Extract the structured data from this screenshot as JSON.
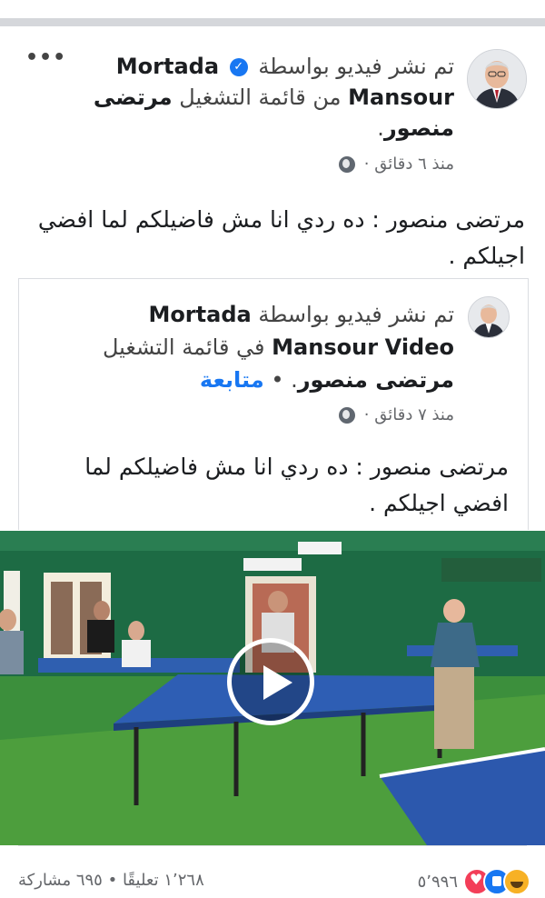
{
  "post": {
    "author": "Mortada Mansour",
    "header_line1_prefix": "تم نشر فيديو بواسطة",
    "header_author_1": "Mortada",
    "header_author_2": "Mansour",
    "header_line2_mid": "من قائمة التشغيل",
    "header_playlist_a": "مرتضى",
    "header_playlist_b": "منصور",
    "header_end": ".",
    "time": "منذ ٦ دقائق",
    "dot": "·",
    "caption": "مرتضى منصور : ده ردي انا مش فاضيلكم  لما افضي اجيلكم .",
    "more_label": "•••"
  },
  "shared": {
    "header_prefix": "تم نشر فيديو بواسطة",
    "author": "Mortada Mansour",
    "video_word": "Video",
    "in_playlist": "في قائمة التشغيل",
    "playlist": "مرتضى منصور",
    "sep": ". •",
    "follow": "متابعة",
    "time": "منذ ٧ دقائق",
    "dot": "·",
    "caption": "مرتضى منصور : ده ردي انا مش فاضيلكم  لما افضي اجيلكم ."
  },
  "footer": {
    "reactions_count": "٥٬٩٩٦",
    "comments": "١٬٢٦٨ تعليقًا",
    "sep": "•",
    "shares": "٦٩٥ مشاركة"
  },
  "colors": {
    "accent": "#1877f2",
    "divider": "#d5d7db",
    "text": "#1c1e21",
    "meta": "#65676b"
  },
  "icons": [
    "verified-badge-icon",
    "globe-icon",
    "more-icon",
    "play-icon",
    "haha-reaction-icon",
    "like-reaction-icon",
    "love-reaction-icon"
  ]
}
